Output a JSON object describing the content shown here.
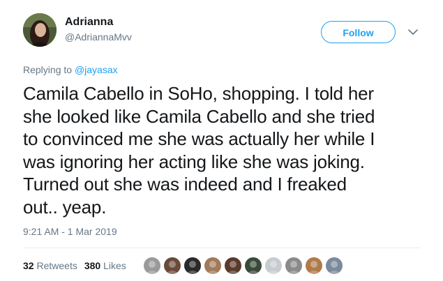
{
  "header": {
    "display_name": "Adrianna",
    "username": "@AdriannaMvv",
    "avatar_icon": "user-avatar-photo",
    "follow_label": "Follow",
    "caret_icon": "chevron-down-icon"
  },
  "reply": {
    "prefix": "Replying to",
    "handle": "@jayasax"
  },
  "tweet": {
    "text": "Camila Cabello in SoHo, shopping. I told her\nshe looked like Camila Cabello and she tried\nto convinced me she was actually her while I\nwas ignoring her acting like she was joking.\nTurned out she was indeed and I freaked\nout.. yeap.",
    "timestamp": "9:21 AM - 1 Mar 2019"
  },
  "stats": {
    "retweets_count": "32",
    "retweets_label": "Retweets",
    "likes_count": "380",
    "likes_label": "Likes"
  },
  "likers": [
    {
      "name": "liker-avatar-1",
      "color": "#9a9a9a"
    },
    {
      "name": "liker-avatar-2",
      "color": "#6b4a3a"
    },
    {
      "name": "liker-avatar-3",
      "color": "#2a2a2a"
    },
    {
      "name": "liker-avatar-4",
      "color": "#a07a5a"
    },
    {
      "name": "liker-avatar-5",
      "color": "#5a3a2a"
    },
    {
      "name": "liker-avatar-6",
      "color": "#3a4a3a"
    },
    {
      "name": "liker-avatar-7",
      "color": "#c8ccd0"
    },
    {
      "name": "liker-avatar-8",
      "color": "#8a8a8a"
    },
    {
      "name": "liker-avatar-9",
      "color": "#b07a4a"
    },
    {
      "name": "liker-avatar-10",
      "color": "#7a8a9a"
    }
  ],
  "colors": {
    "accent": "#1da1f2",
    "text_primary": "#14171a",
    "text_secondary": "#657786",
    "divider": "#e6ecf0"
  }
}
